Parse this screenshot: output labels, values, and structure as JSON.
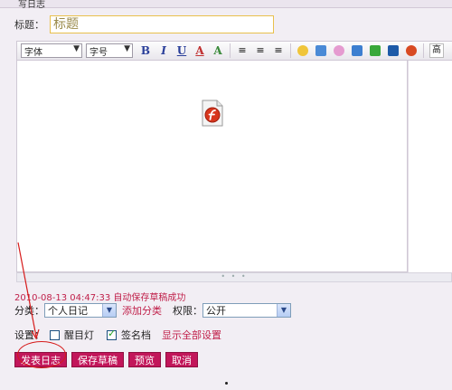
{
  "header": {
    "cut_text": "写日志"
  },
  "title": {
    "label": "标题：",
    "value": "标题"
  },
  "toolbar": {
    "font_label": "字体",
    "size_label": "字号",
    "bold": "B",
    "italic": "I",
    "underline": "U",
    "font_color": "A",
    "highlight": "A",
    "extra_label": "高"
  },
  "autosave": {
    "text": "2010-08-13 04:47:33 自动保存草稿成功"
  },
  "category": {
    "label": "分类：",
    "value": "个人日记",
    "add_link": "添加分类"
  },
  "permission": {
    "label": "权限：",
    "value": "公开"
  },
  "settings": {
    "label": "设置：",
    "eye_light": "醒目灯",
    "eye_light_checked": false,
    "signature": "签名档",
    "signature_checked": true,
    "show_all": "显示全部设置"
  },
  "buttons": {
    "publish": "发表日志",
    "save_draft": "保存草稿",
    "preview": "预览",
    "cancel": "取消"
  },
  "colors": {
    "accent": "#c2165a",
    "link": "#c0204a",
    "annotation": "#d61b1b"
  }
}
